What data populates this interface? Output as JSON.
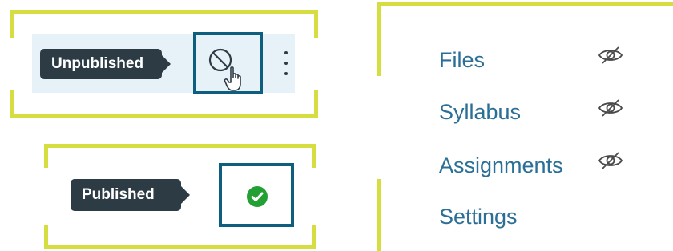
{
  "colors": {
    "accent": "#d6de3f",
    "teal_highlight": "#0e5f7f",
    "tooltip_bg": "#2d3b45",
    "link": "#2b6f96",
    "published_green": "#23a033",
    "row_highlight": "#e6f1f8"
  },
  "unpublished_row": {
    "tooltip": "Unpublished",
    "status_icon": "unpublished-circle-slash-icon",
    "cursor_icon": "hand-pointer-icon",
    "menu_icon": "kebab-menu-icon"
  },
  "published_row": {
    "tooltip": "Published",
    "status_icon": "published-check-icon"
  },
  "nav": {
    "items": [
      {
        "label": "Files",
        "hidden_icon": "eye-slash-icon"
      },
      {
        "label": "Syllabus",
        "hidden_icon": "eye-slash-icon"
      },
      {
        "label": "Assignments",
        "hidden_icon": "eye-slash-icon"
      },
      {
        "label": "Settings"
      }
    ]
  }
}
